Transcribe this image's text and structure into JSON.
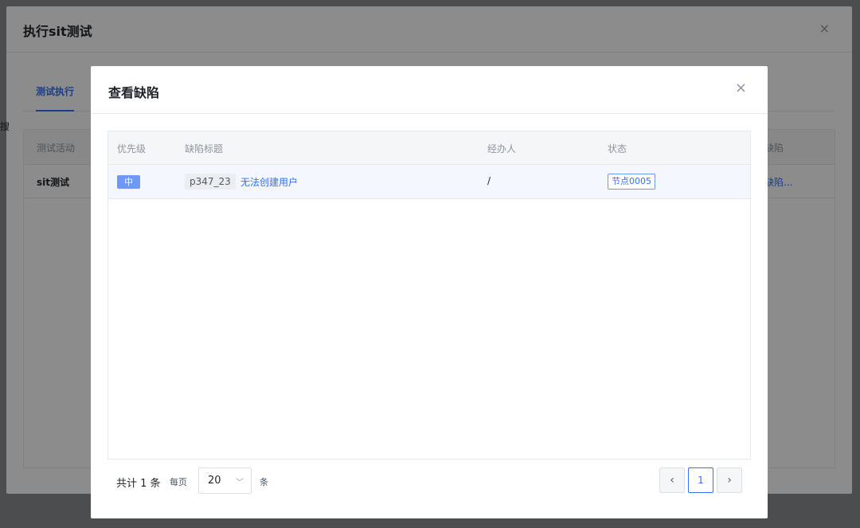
{
  "background_dialog": {
    "title": "执行sit测试",
    "close_glyph": "×",
    "tab_label": "测试执行",
    "left_glyph": "搜",
    "table_headers": [
      "测试活动",
      "缺陷"
    ],
    "row": {
      "activity": "sit测试",
      "defect_link": "缺陷..."
    }
  },
  "modal": {
    "title": "查看缺陷",
    "close_glyph": "×",
    "columns": [
      "优先级",
      "缺陷标题",
      "经办人",
      "状态"
    ],
    "rows": [
      {
        "priority": "中",
        "defect_id": "p347_23",
        "defect_title": "无法创建用户",
        "assignee": "/",
        "status": "节点0005"
      }
    ],
    "pagination": {
      "total_text": "共计 1 条",
      "per_page_label": "每页",
      "page_size": "20",
      "unit": "条",
      "current_page": "1",
      "prev_glyph": "‹",
      "next_glyph": "›",
      "dropdown_glyph": "﹀"
    }
  },
  "colors": {
    "accent": "#3370ff",
    "priority_badge": "#6e9af5",
    "row_highlight": "#f4f7fe"
  }
}
